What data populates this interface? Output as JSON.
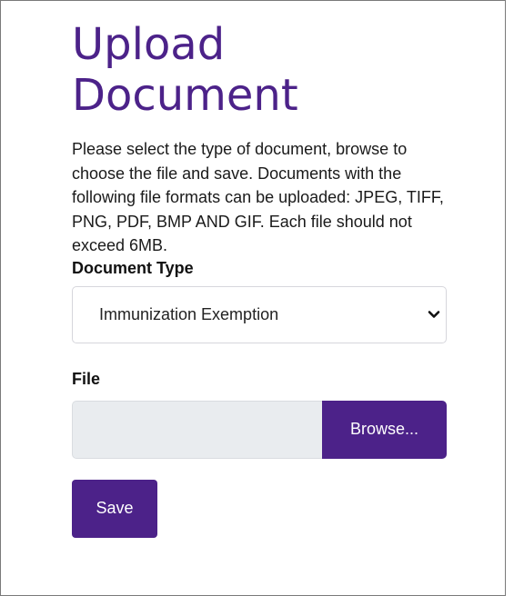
{
  "page": {
    "title_line1": "Upload",
    "title_line2": "Document",
    "description": "Please select the type of document, browse to choose the file and save. Documents with the following file formats can be uploaded: JPEG, TIFF, PNG, PDF, BMP AND GIF. Each file should not exceed 6MB."
  },
  "document_type": {
    "label": "Document Type",
    "selected": "Immunization Exemption",
    "icon": "chevron-down-icon"
  },
  "file": {
    "label": "File",
    "value": "",
    "browse_label": "Browse..."
  },
  "actions": {
    "save_label": "Save"
  },
  "colors": {
    "brand": "#4c2289",
    "input_bg": "#e9ecef"
  }
}
